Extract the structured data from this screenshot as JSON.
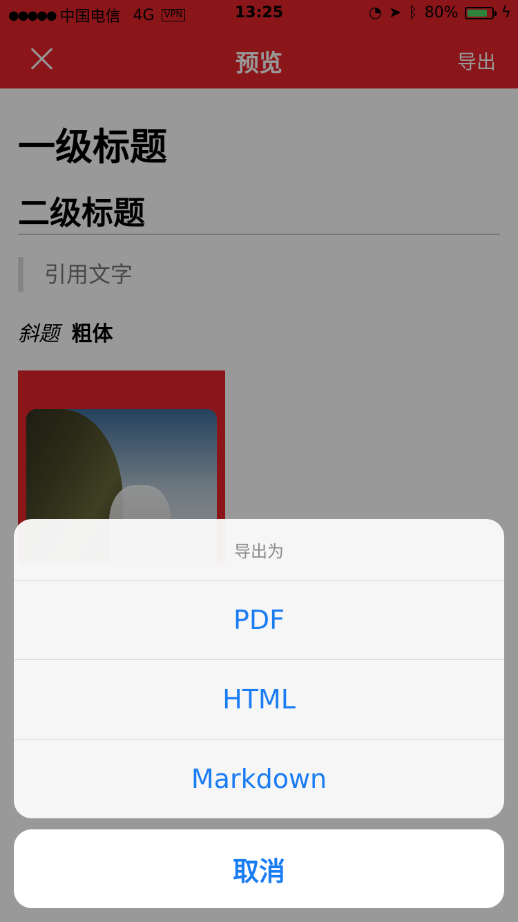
{
  "status_bar": {
    "carrier": "中国电信",
    "network": "4G",
    "vpn": "VPN",
    "time": "13:25",
    "battery_percent": "80%",
    "battery_level": 0.8,
    "battery_color": "#4cd964"
  },
  "nav": {
    "title": "预览",
    "export_label": "导出",
    "close_icon": "close-icon",
    "bar_color": "#e6252c"
  },
  "document": {
    "h1": "一级标题",
    "h2": "二级标题",
    "quote": "引用文字",
    "italic_text": "斜题",
    "bold_text": "粗体"
  },
  "action_sheet": {
    "title": "导出为",
    "options": [
      "PDF",
      "HTML",
      "Markdown"
    ],
    "cancel_label": "取消",
    "accent_color": "#1a7cf3"
  }
}
